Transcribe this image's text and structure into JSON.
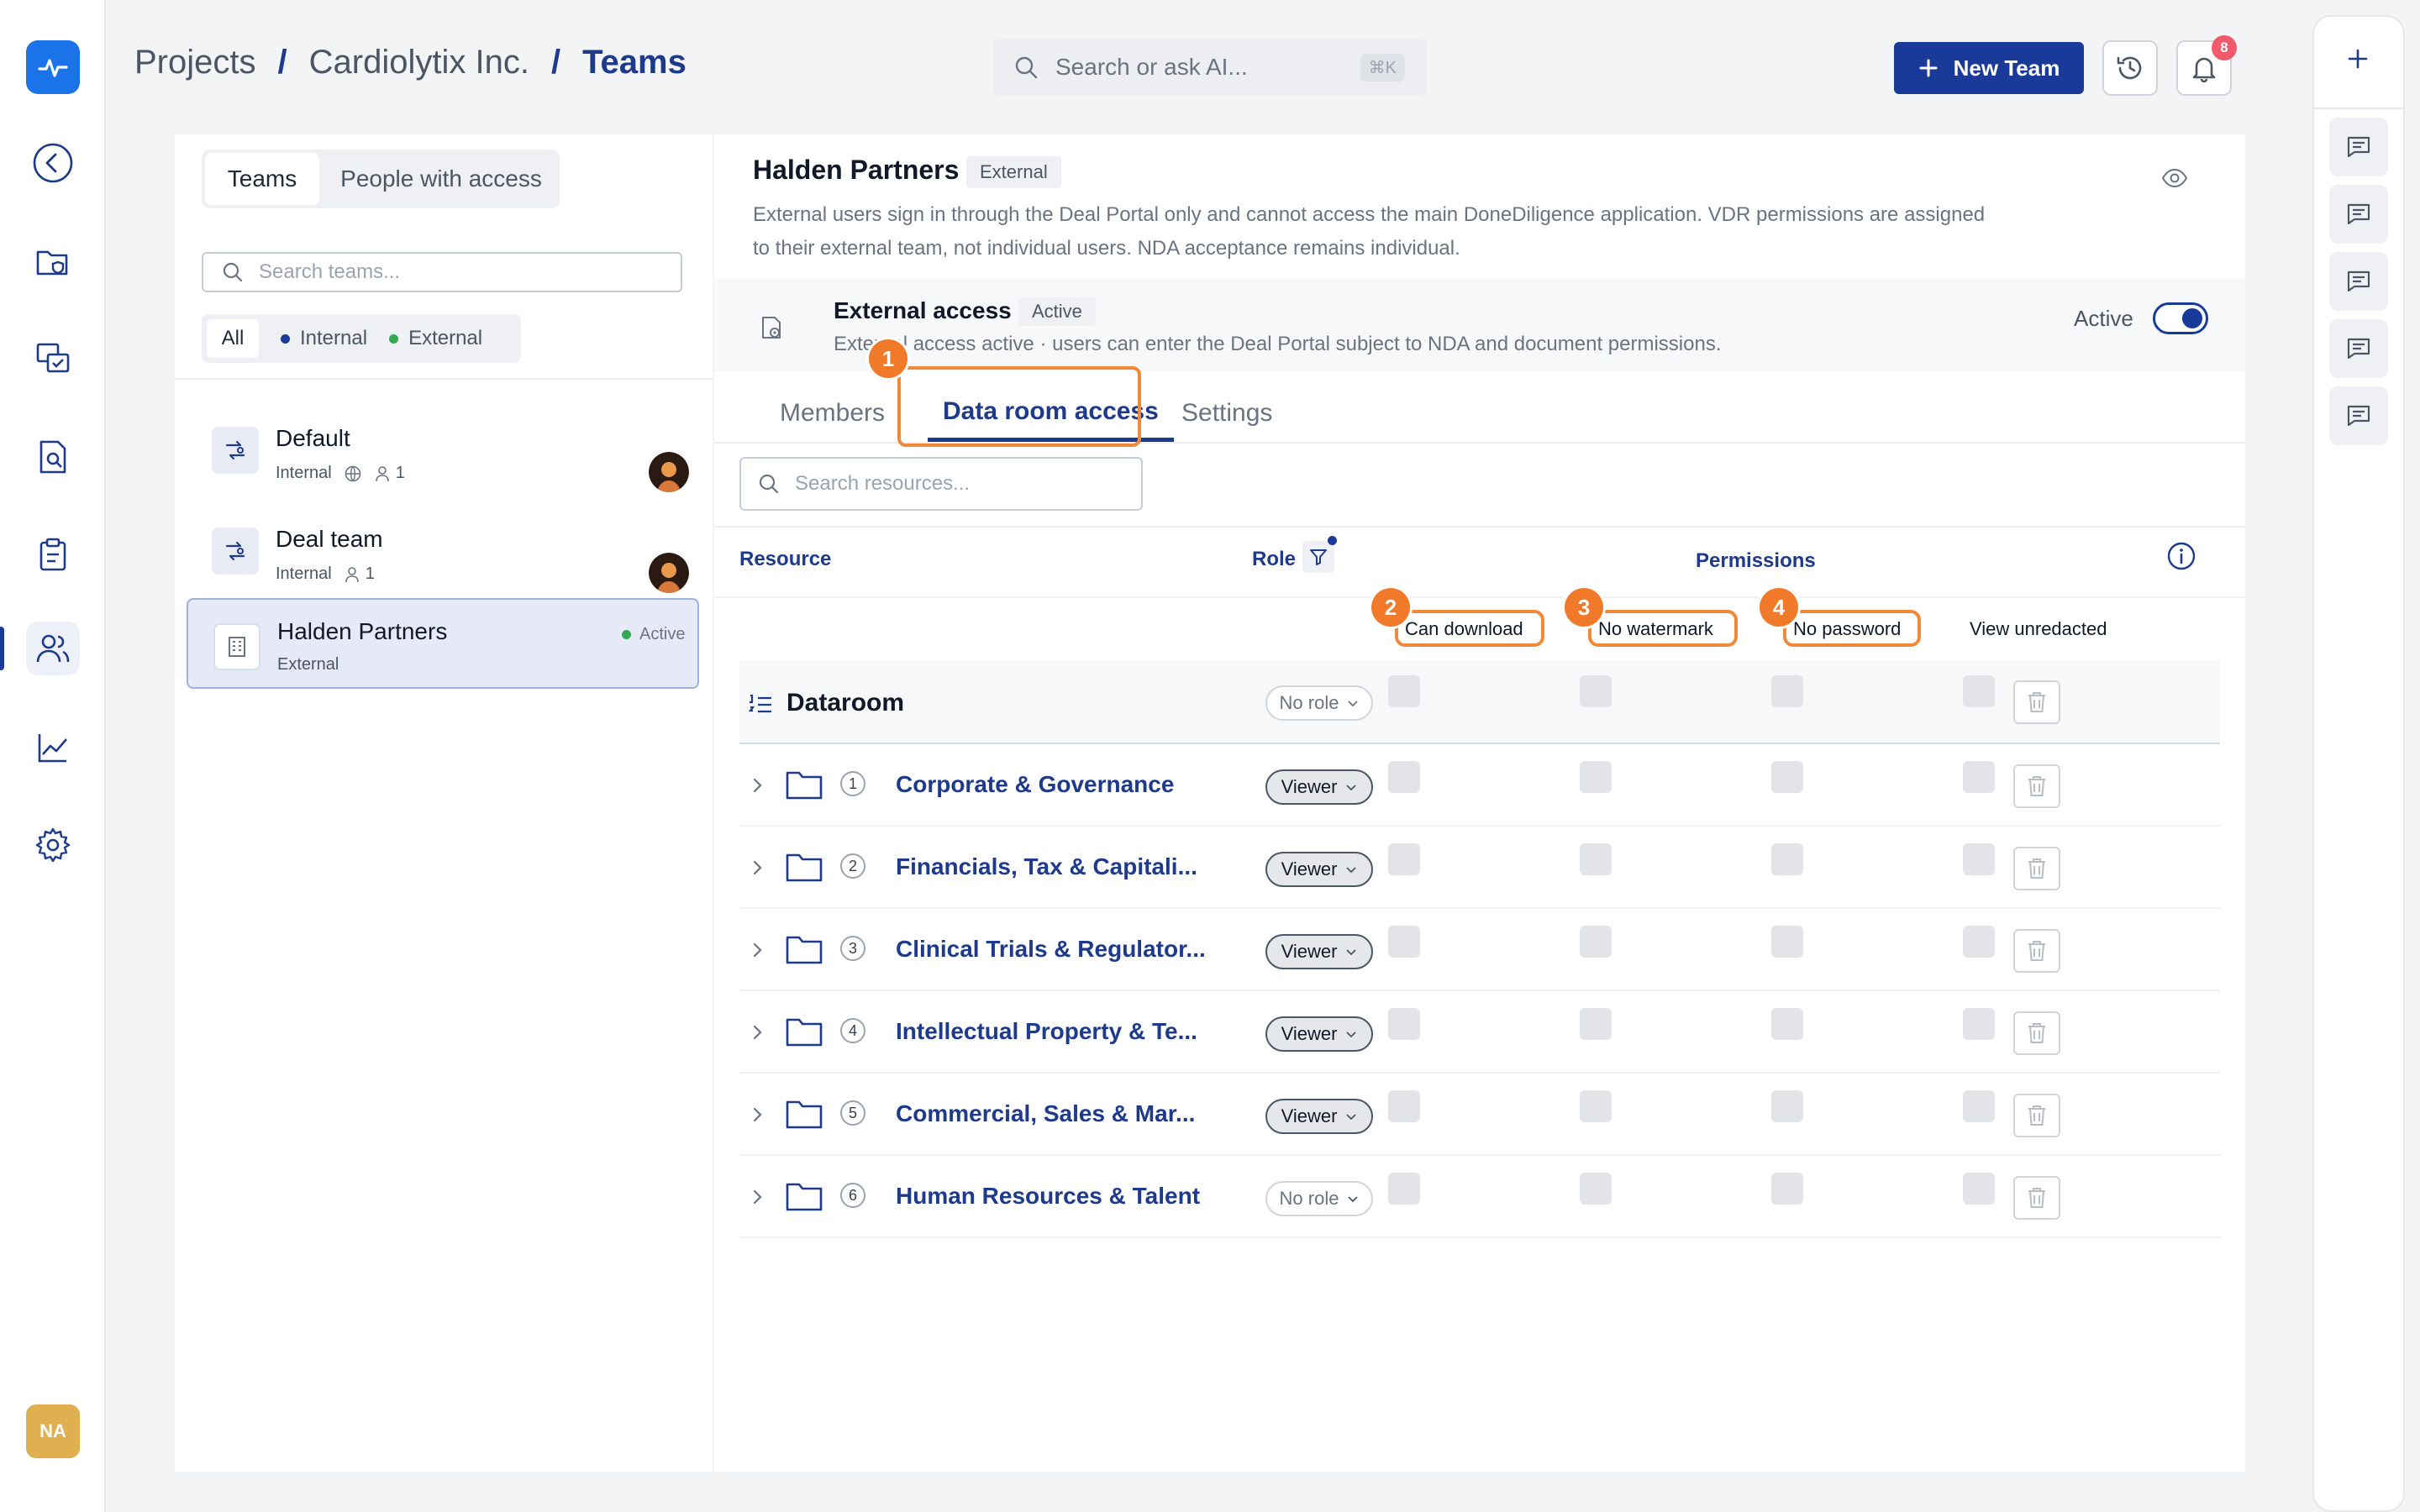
{
  "nav": {
    "logo_icon": "pulse-logo-icon",
    "items": [
      {
        "name": "back",
        "icon": "chevron-left-circle-icon"
      },
      {
        "name": "folders",
        "icon": "folder-shield-icon"
      },
      {
        "name": "qa",
        "icon": "chat-check-icon"
      },
      {
        "name": "review",
        "icon": "document-search-icon"
      },
      {
        "name": "checklist",
        "icon": "clipboard-icon"
      },
      {
        "name": "teams",
        "icon": "users-icon",
        "active": true
      },
      {
        "name": "analytics",
        "icon": "line-chart-icon"
      },
      {
        "name": "settings",
        "icon": "gear-icon"
      }
    ],
    "user_initials": "NA"
  },
  "header": {
    "breadcrumb": [
      "Projects",
      "Cardiolytix Inc.",
      "Teams"
    ],
    "separator": "/",
    "search_placeholder": "Search or ask AI...",
    "search_shortcut": "⌘K",
    "new_team_label": "New Team",
    "notification_count": "8"
  },
  "left_panel": {
    "tabs": [
      "Teams",
      "People with access"
    ],
    "search_placeholder": "Search teams...",
    "filters": [
      {
        "label": "All"
      },
      {
        "label": "Internal",
        "color": "#1a3a9a"
      },
      {
        "label": "External",
        "color": "#34a853"
      }
    ],
    "teams": [
      {
        "name": "Default",
        "type": "Internal",
        "members": "1",
        "has_globe": true
      },
      {
        "name": "Deal team",
        "type": "Internal",
        "members": "1",
        "has_globe": false
      },
      {
        "name": "Halden Partners",
        "type": "External",
        "status": "Active",
        "selected": true
      }
    ]
  },
  "main": {
    "title": "Halden Partners",
    "type_badge": "External",
    "description": "External users sign in through the Deal Portal only and cannot access the main DoneDiligence application. VDR permissions are assigned to their external team, not individual users. NDA acceptance remains individual.",
    "external_access": {
      "title": "External access",
      "badge": "Active",
      "description": "External access active · users can enter the Deal Portal subject to NDA and document permissions.",
      "toggle_label": "Active",
      "toggle_on": true
    },
    "tabs": [
      "Members",
      "Data room access",
      "Settings"
    ],
    "active_tab": "Data room access",
    "resource_search_placeholder": "Search resources...",
    "table": {
      "col_resource": "Resource",
      "col_role": "Role",
      "col_permissions": "Permissions",
      "permission_columns": [
        "Can download",
        "No watermark",
        "No password",
        "View unredacted"
      ],
      "root": {
        "name": "Dataroom",
        "role": "No role"
      },
      "rows": [
        {
          "index": "1",
          "name": "Corporate & Governance",
          "role": "Viewer"
        },
        {
          "index": "2",
          "name": "Financials, Tax & Capitali...",
          "role": "Viewer"
        },
        {
          "index": "3",
          "name": "Clinical Trials & Regulator...",
          "role": "Viewer"
        },
        {
          "index": "4",
          "name": "Intellectual Property & Te...",
          "role": "Viewer"
        },
        {
          "index": "5",
          "name": "Commercial, Sales & Mar...",
          "role": "Viewer"
        },
        {
          "index": "6",
          "name": "Human Resources & Talent",
          "role": "No role"
        }
      ]
    },
    "callouts": [
      "1",
      "2",
      "3",
      "4"
    ],
    "highlight_color": "#f08a3a"
  }
}
